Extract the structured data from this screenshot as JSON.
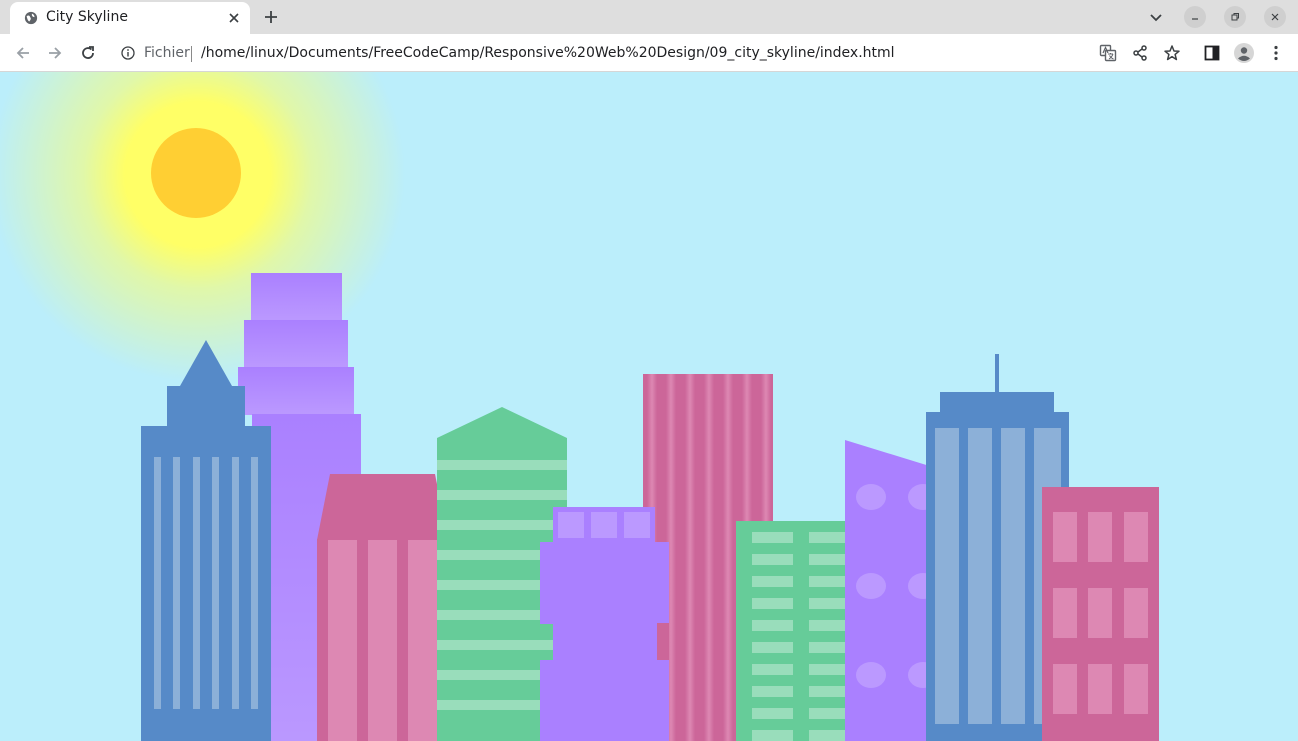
{
  "browser": {
    "tab": {
      "title": "City Skyline",
      "favicon": "globe-icon",
      "close_icon": "close-icon"
    },
    "new_tab_icon": "plus-icon",
    "window_controls": [
      "chevron-down-icon",
      "minimize-icon",
      "restore-icon",
      "close-icon"
    ],
    "toolbar": {
      "back_icon": "arrow-left-icon",
      "forward_icon": "arrow-right-icon",
      "reload_icon": "reload-icon",
      "site_info_icon": "info-icon",
      "scheme_label": "Fichier",
      "url": "/home/linux/Documents/FreeCodeCamp/Responsive%20Web%20Design/09_city_skyline/index.html",
      "right_icons": [
        "translate-icon",
        "share-icon",
        "star-icon",
        "side-panel-icon",
        "profile-icon",
        "more-vert-icon"
      ]
    }
  },
  "scene": {
    "sky_color": "#bbeefb",
    "sun_color": "#ffcf33",
    "colors": {
      "blue": "#568ac8",
      "purple": "#aa80ff",
      "pink": "#cc6699",
      "green": "#66cc99"
    }
  }
}
